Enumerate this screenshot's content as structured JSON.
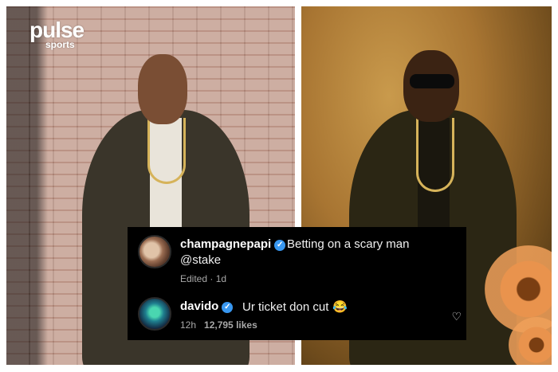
{
  "branding": {
    "logo_main": "pulse",
    "logo_sub": "sports"
  },
  "comments": [
    {
      "username": "champagnepapi",
      "verified": true,
      "text_line1": "Betting on a scary man",
      "text_line2": "@stake",
      "edited": "Edited · 1d",
      "avatar_icon": "avatar-photo-icon"
    },
    {
      "username": "davido",
      "verified": true,
      "text": "Ur ticket don cut",
      "emoji": "😂",
      "time": "12h",
      "likes": "12,795 likes",
      "like_icon": "heart-icon",
      "avatar_icon": "avatar-photo-icon"
    }
  ],
  "colors": {
    "comment_bg": "#000000",
    "verified": "#3897f0",
    "meta": "#a8a8a8"
  }
}
